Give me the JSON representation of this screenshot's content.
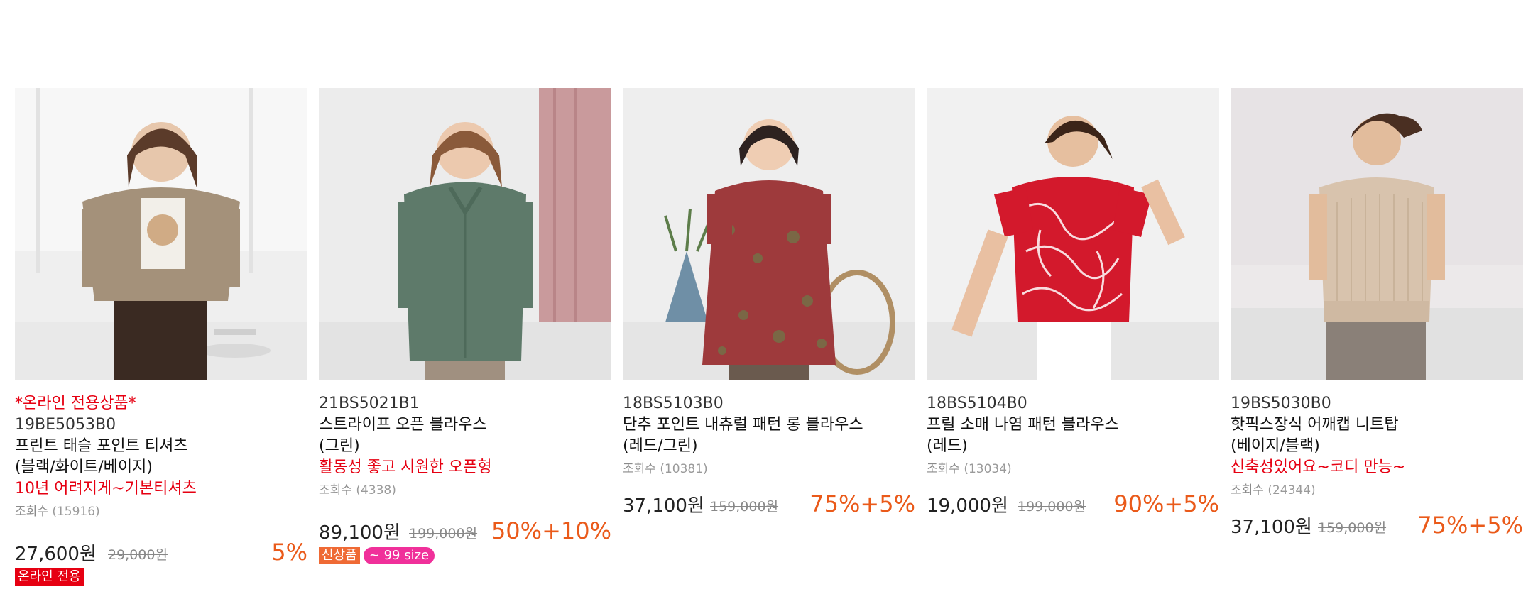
{
  "ui": {
    "views_label": "조회수"
  },
  "products": [
    {
      "tag": "*온라인 전용상품*",
      "code": "19BE5053B0",
      "name_line1": "프린트 태슬 포인트 티셔츠",
      "name_line2": "(블랙/화이트/베이지)",
      "promo": "10년 어려지게~기본티셔츠",
      "views": "(15916)",
      "price": "27,600원",
      "original_price": "29,000원",
      "discount": "5%",
      "badges": [
        "온라인 전용"
      ]
    },
    {
      "tag": "",
      "code": "21BS5021B1",
      "name_line1": "스트라이프 오픈 블라우스",
      "name_line2": "(그린)",
      "promo": "활동성 좋고 시원한 오픈형",
      "views": "(4338)",
      "price": "89,100원",
      "original_price": "199,000원",
      "discount": "50%+10%",
      "badges": [
        "신상품",
        "~ 99 size"
      ]
    },
    {
      "tag": "",
      "code": "18BS5103B0",
      "name_line1": "단추 포인트 내츄럴 패턴 롱 블라우스",
      "name_line2": "(레드/그린)",
      "promo": "",
      "views": "(10381)",
      "price": "37,100원",
      "original_price": "159,000원",
      "discount": "75%+5%",
      "badges": []
    },
    {
      "tag": "",
      "code": "18BS5104B0",
      "name_line1": "프릴 소매 나염 패턴 블라우스",
      "name_line2": "(레드)",
      "promo": "",
      "views": "(13034)",
      "price": "19,000원",
      "original_price": "199,000원",
      "discount": "90%+5%",
      "badges": []
    },
    {
      "tag": "",
      "code": "19BS5030B0",
      "name_line1": "핫픽스장식 어깨캡 니트탑",
      "name_line2": "(베이지/블랙)",
      "promo": "신축성있어요~코디 만능~",
      "views": "(24344)",
      "price": "37,100원",
      "original_price": "159,000원",
      "discount": "75%+5%",
      "badges": []
    }
  ]
}
